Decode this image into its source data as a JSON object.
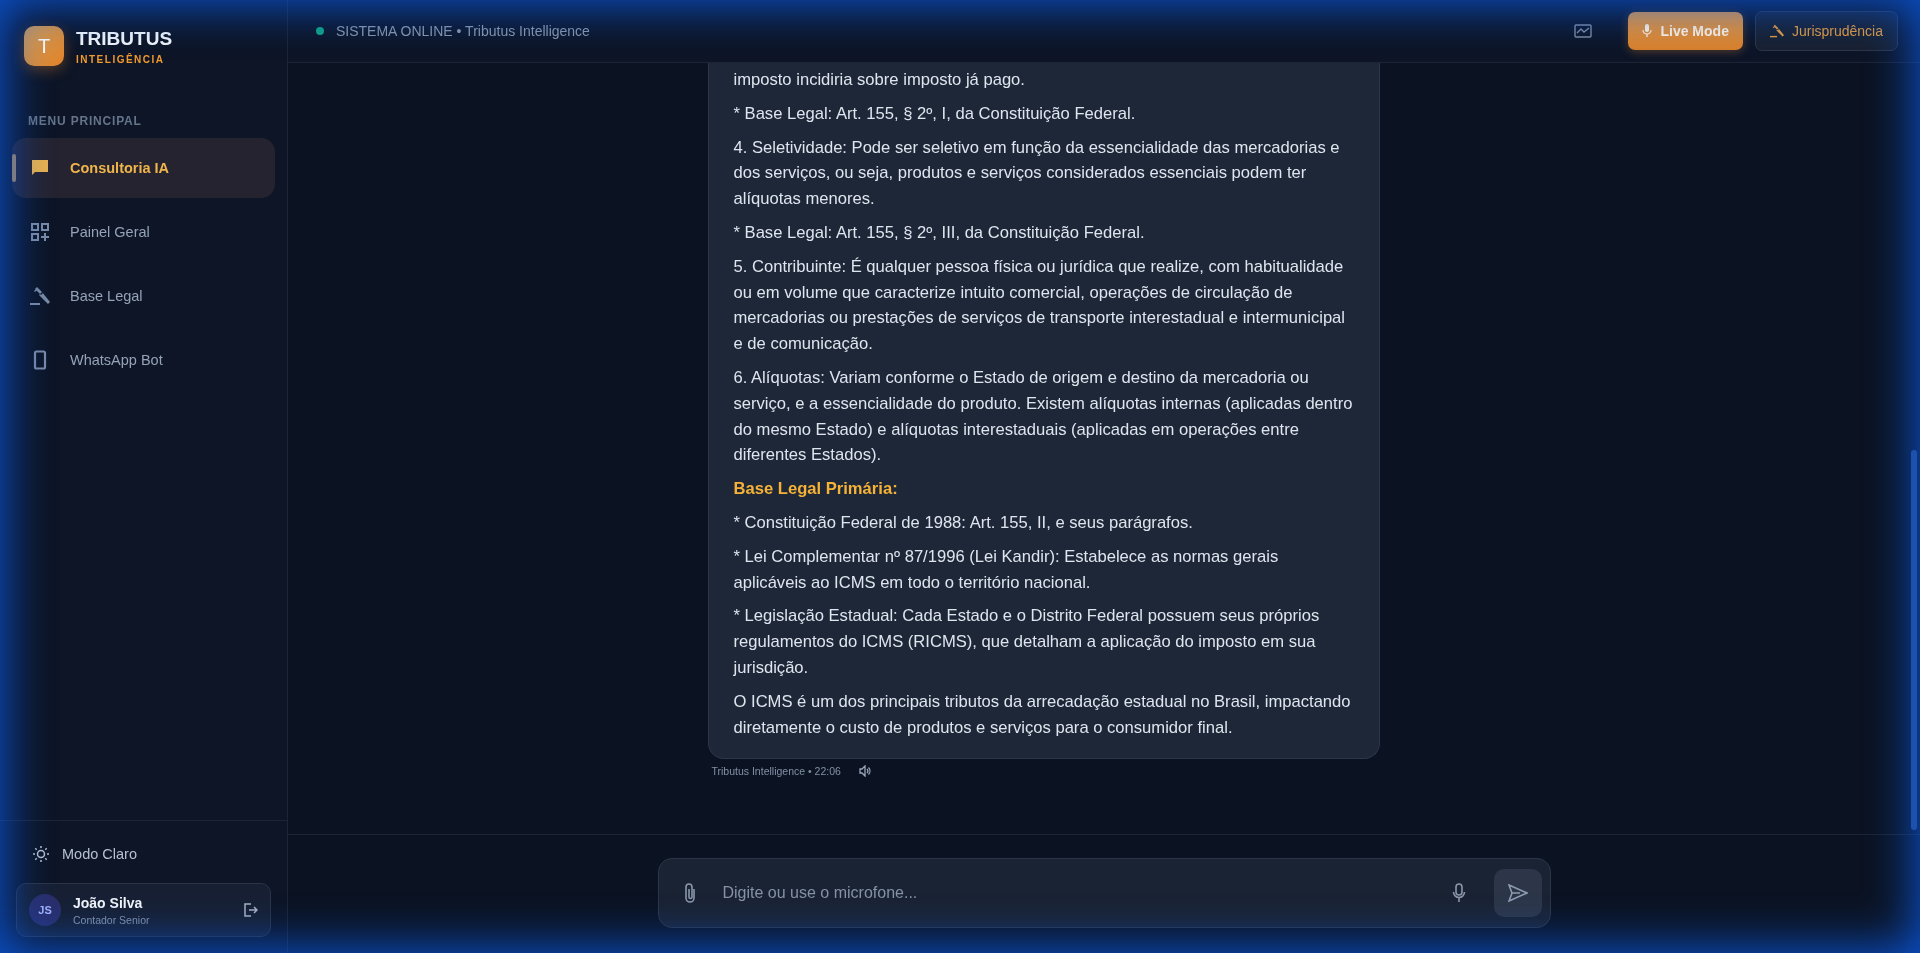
{
  "brand": {
    "logo_letter": "T",
    "name": "TRIBUTUS",
    "tagline": "INTELIGÊNCIA"
  },
  "sidebar": {
    "section_title": "MENU PRINCIPAL",
    "items": [
      {
        "label": "Consultoria IA",
        "kind": "chat",
        "selected": true
      },
      {
        "label": "Painel Geral",
        "kind": "grid",
        "selected": false
      },
      {
        "label": "Base Legal",
        "kind": "gavel",
        "selected": false
      },
      {
        "label": "WhatsApp Bot",
        "kind": "phone",
        "selected": false
      }
    ],
    "theme_toggle": {
      "label": "Modo Claro"
    },
    "user": {
      "initials": "JS",
      "name": "João Silva",
      "role": "Contador Senior"
    }
  },
  "header": {
    "status": "SISTEMA ONLINE • Tributus Intelligence",
    "online": true,
    "buttons": [
      {
        "label": "Live Mode",
        "kind": "primary"
      },
      {
        "label": "Jurisprudência",
        "kind": "secondary"
      }
    ]
  },
  "message": {
    "paragraphs": [
      {
        "kind": "text",
        "text": "imposto incidiria sobre imposto já pago."
      },
      {
        "kind": "text",
        "text": "* Base Legal: Art. 155, § 2º, I, da Constituição Federal."
      },
      {
        "kind": "text",
        "text": "4. Seletividade: Pode ser seletivo em função da essencialidade das mercadorias e dos serviços, ou seja, produtos e serviços considerados essenciais podem ter alíquotas menores."
      },
      {
        "kind": "text",
        "text": "* Base Legal: Art. 155, § 2º, III, da Constituição Federal."
      },
      {
        "kind": "text",
        "text": "5. Contribuinte: É qualquer pessoa física ou jurídica que realize, com habitualidade ou em volume que caracterize intuito comercial, operações de circulação de mercadorias ou prestações de serviços de transporte interestadual e intermunicipal e de comunicação."
      },
      {
        "kind": "text",
        "text": "6. Alíquotas: Variam conforme o Estado de origem e destino da mercadoria ou serviço, e a essencialidade do produto. Existem alíquotas internas (aplicadas dentro do mesmo Estado) e alíquotas interestaduais (aplicadas em operações entre diferentes Estados)."
      },
      {
        "kind": "heading",
        "text": "Base Legal Primária:"
      },
      {
        "kind": "text",
        "text": "* Constituição Federal de 1988: Art. 155, II, e seus parágrafos."
      },
      {
        "kind": "text",
        "text": "* Lei Complementar nº 87/1996 (Lei Kandir): Estabelece as normas gerais aplicáveis ao ICMS em todo o território nacional."
      },
      {
        "kind": "text",
        "text": "* Legislação Estadual: Cada Estado e o Distrito Federal possuem seus próprios regulamentos do ICMS (RICMS), que detalham a aplicação do imposto em sua jurisdição."
      },
      {
        "kind": "text",
        "text": "O ICMS é um dos principais tributos da arrecadação estadual no Brasil, impactando diretamente o custo de produtos e serviços para o consumidor final."
      }
    ],
    "meta": "Tributus Intelligence • 22:06"
  },
  "composer": {
    "placeholder": "Digite ou use o microfone..."
  }
}
